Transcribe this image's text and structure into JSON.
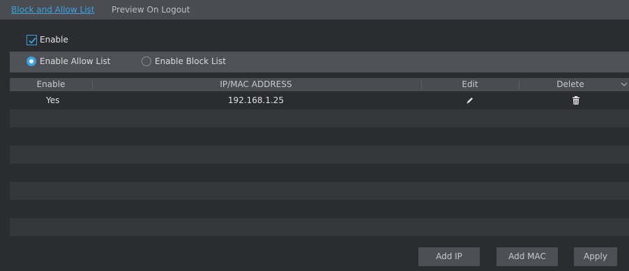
{
  "tabs": [
    {
      "label": "Block and Allow List",
      "active": true
    },
    {
      "label": "Preview On Logout",
      "active": false
    }
  ],
  "enable": {
    "label": "Enable",
    "checked": true
  },
  "list_mode": {
    "options": [
      {
        "label": "Enable Allow List",
        "selected": true
      },
      {
        "label": "Enable Block List",
        "selected": false
      }
    ]
  },
  "table": {
    "columns": [
      "Enable",
      "IP/MAC ADDRESS",
      "Edit",
      "Delete"
    ],
    "rows": [
      {
        "enable": "Yes",
        "address": "192.168.1.25",
        "edit_icon": "pencil-icon",
        "delete_icon": "trash-icon"
      }
    ]
  },
  "buttons": {
    "add_ip": "Add IP",
    "add_mac": "Add MAC",
    "apply": "Apply"
  },
  "colors": {
    "accent": "#3aa3df",
    "background": "#2b2c2f",
    "bar": "#4a4c52",
    "row_alt": "#34363a"
  }
}
